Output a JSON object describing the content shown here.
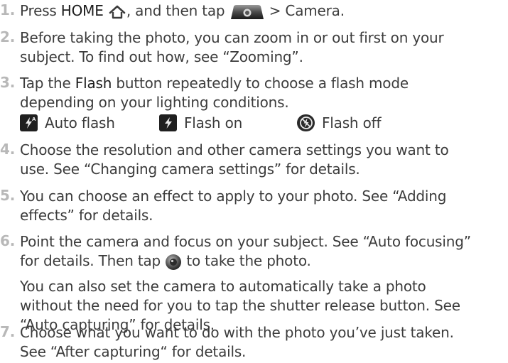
{
  "steps": [
    {
      "number": "1.",
      "text": {
        "pre": "Press ",
        "home": "HOME",
        "mid": ", and then tap ",
        "post": " > Camera."
      }
    },
    {
      "number": "2.",
      "lines": [
        "Before taking the photo, you can zoom in or out first on your",
        "subject. To find out how, see “Zooming”."
      ]
    },
    {
      "number": "3.",
      "line1": {
        "pre": "Tap the ",
        "bold": "Flash",
        "post": " button repeatedly to choose a flash mode"
      },
      "line2": "depending on your lighting conditions.",
      "flash_modes": [
        {
          "icon": "auto-flash-icon",
          "label": "Auto flash"
        },
        {
          "icon": "flash-on-icon",
          "label": "Flash on"
        },
        {
          "icon": "flash-off-icon",
          "label": "Flash off"
        }
      ]
    },
    {
      "number": "4.",
      "lines": [
        "Choose the resolution and other camera settings you want to",
        "use. See “Changing camera settings” for details."
      ]
    },
    {
      "number": "5.",
      "lines": [
        "You can choose an effect to apply to your photo. See “Adding",
        "effects” for details."
      ]
    },
    {
      "number": "6.",
      "line1": "Point the camera and focus on your subject. See “Auto focusing”",
      "line2": {
        "pre": "for details. Then tap ",
        "post": " to take the photo."
      },
      "para": [
        "You can also set the camera to automatically take a photo",
        "without the need for you to tap the shutter release button. See",
        "“Auto capturing” for details."
      ]
    },
    {
      "number": "7.",
      "lines": [
        "Choose what you want to do with the photo you’ve just taken.",
        "See “After capturing“ for details."
      ]
    }
  ],
  "colors": {
    "text": "#3c3c3c",
    "number": "#b8b8b8",
    "flash_icon_bg": "#1f1f1f",
    "flash_icon_fg": "#e8e8e8"
  }
}
